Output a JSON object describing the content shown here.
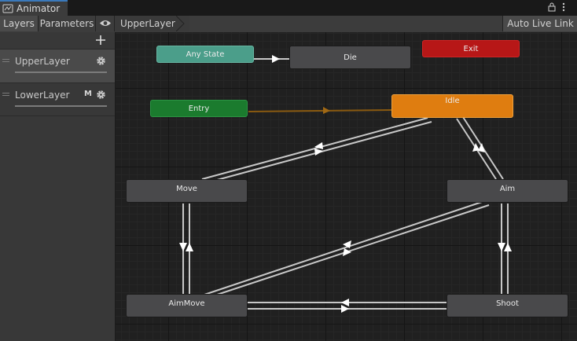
{
  "window": {
    "tab_title": "Animator"
  },
  "toolbar": {
    "layers_label": "Layers",
    "parameters_label": "Parameters",
    "breadcrumb": "UpperLayer",
    "auto_live_link": "Auto Live Link"
  },
  "layers": [
    {
      "name": "UpperLayer",
      "selected": true,
      "badge": ""
    },
    {
      "name": "LowerLayer",
      "selected": false,
      "badge": "M"
    }
  ],
  "states": {
    "any_state": "Any State",
    "die": "Die",
    "exit": "Exit",
    "entry": "Entry",
    "idle": "Idle",
    "move": "Move",
    "aim": "Aim",
    "aimmove": "AimMove",
    "shoot": "Shoot"
  },
  "colors": {
    "any_state": "#4b9e8a",
    "exit": "#b71717",
    "entry": "#1b7b2e",
    "idle_default": "#df7d10",
    "state": "#49494b",
    "transition": "#c8c8c8",
    "entry_transition": "#8a5a10"
  }
}
